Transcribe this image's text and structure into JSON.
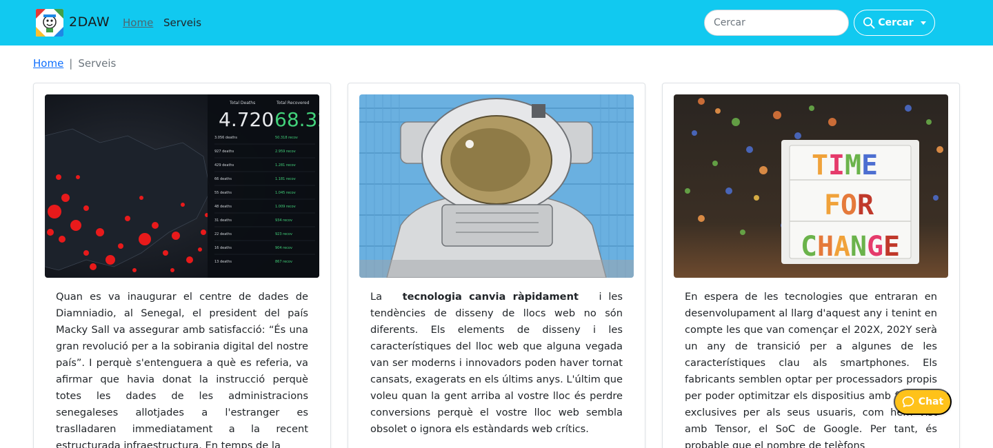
{
  "navbar": {
    "brand": "2DAW",
    "links": [
      {
        "label": "Home"
      },
      {
        "label": "Serveis"
      }
    ],
    "search": {
      "placeholder": "Cercar",
      "button_label": "Cercar"
    }
  },
  "breadcrumb": {
    "home": "Home",
    "separator": "|",
    "current": "Serveis"
  },
  "cards": [
    {
      "image_alt": "Map with COVID-19 statistics dashboard",
      "text": "Quan es va inaugurar el centre de dades de Diamniadio, al Senegal, el president del país Macky Sall va assegurar amb satisfacció: “És una gran revolució per a la sobirania digital del nostre país”. I perquè s'entenguera a què es referia, va afirmar que havia donat la instrucció perquè totes les dades de les administracions senegaleses allotjades a l'estranger es traslladaren immediatament a la recent estructurada infraestructura. En temps de la"
    },
    {
      "image_alt": "Astronaut mural painted on shipping containers",
      "text_prefix": "La",
      "text_bold": "tecnologia canvia ràpidament",
      "text_suffix": "i les tendències de disseny de llocs web no són diferents. Els elements de disseny i les característiques del lloc web que alguna vegada van ser moderns i innovadors poden haver tornat cansats, exagerats en els últims anys. L'últim que voleu quan la gent arriba al vostre lloc és perdre conversions perquè el vostre lloc web sembla obsolet o ignora els estàndards web crítics."
    },
    {
      "image_alt": "Lightbox with TIME FOR CHANGE",
      "image_words": [
        "TIME",
        "FOR",
        "CHANGE"
      ],
      "text": "En espera de les tecnologies que entraran en desenvolupament al llarg d'aquest any i tenint en compte les que van començar el 202X, 202Y serà un any de transició per a algunes de les característiques clau als smartphones. Els fabricants semblen optar per processadors propis per poder optimitzar els dispositius amb funcions exclusives per als seus usuaris, com hem vist amb Tensor, el SoC de Google. Per tant, és probable que el nombre de telèfons"
    }
  ],
  "chat": {
    "label": "Chat"
  },
  "colors": {
    "navbar": "#11c9f0",
    "chat": "#ffc21a",
    "link": "#0d6efd"
  }
}
